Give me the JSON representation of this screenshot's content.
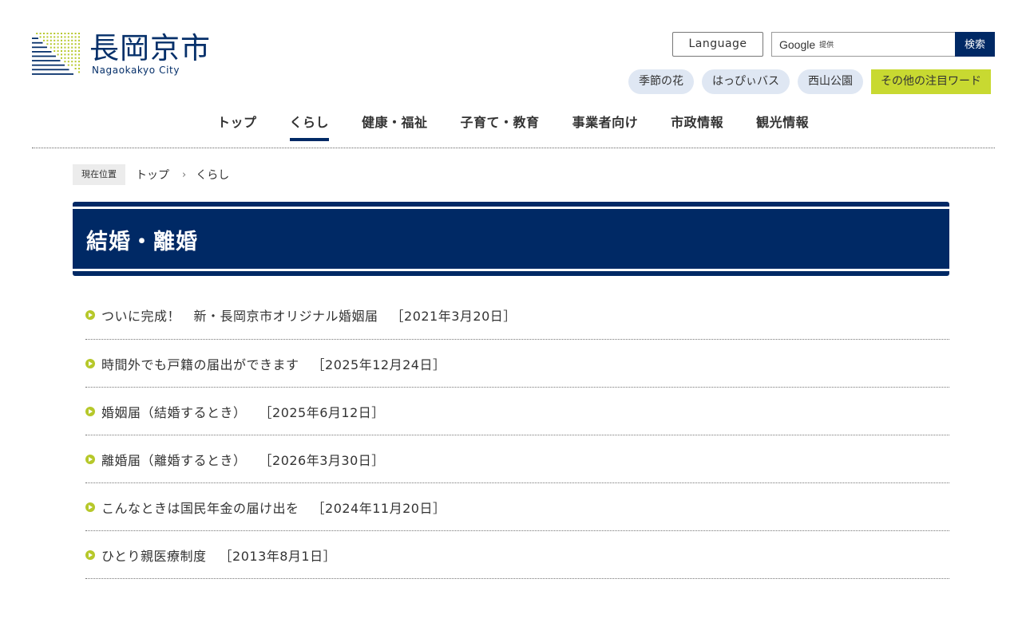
{
  "logo": {
    "title": "長岡京市",
    "subtitle": "Nagaokakyo City",
    "icon": "city-emblem-icon"
  },
  "header": {
    "language_label": "Language",
    "search": {
      "provider": "Google",
      "provider_suffix": "提供",
      "button_label": "検索"
    },
    "keywords": [
      "季節の花",
      "はっぴぃバス",
      "西山公園"
    ],
    "more_keywords_label": "その他の注目ワード"
  },
  "nav": {
    "items": [
      {
        "label": "トップ",
        "active": false
      },
      {
        "label": "くらし",
        "active": true
      },
      {
        "label": "健康・福祉",
        "active": false
      },
      {
        "label": "子育て・教育",
        "active": false
      },
      {
        "label": "事業者向け",
        "active": false
      },
      {
        "label": "市政情報",
        "active": false
      },
      {
        "label": "観光情報",
        "active": false
      }
    ]
  },
  "breadcrumb": {
    "label": "現在位置",
    "parent": "トップ",
    "separator": "›",
    "current": "くらし"
  },
  "page": {
    "title": "結婚・離婚"
  },
  "articles": [
    {
      "title": "ついに完成！　新・長岡京市オリジナル婚姻届",
      "date": "［2021年3月20日］"
    },
    {
      "title": "時間外でも戸籍の届出ができます",
      "date": "［2025年12月24日］"
    },
    {
      "title": "婚姻届（結婚するとき）",
      "date": "［2025年6月12日］"
    },
    {
      "title": "離婚届（離婚するとき）",
      "date": "［2026年3月30日］"
    },
    {
      "title": "こんなときは国民年金の届け出を",
      "date": "［2024年11月20日］"
    },
    {
      "title": "ひとり親医療制度",
      "date": "［2013年8月1日］"
    }
  ],
  "colors": {
    "brand_navy": "#002965",
    "accent_lime": "#c8d931",
    "bullet_green": "#b6c82a",
    "keyword_bg": "#dfe7f3"
  }
}
